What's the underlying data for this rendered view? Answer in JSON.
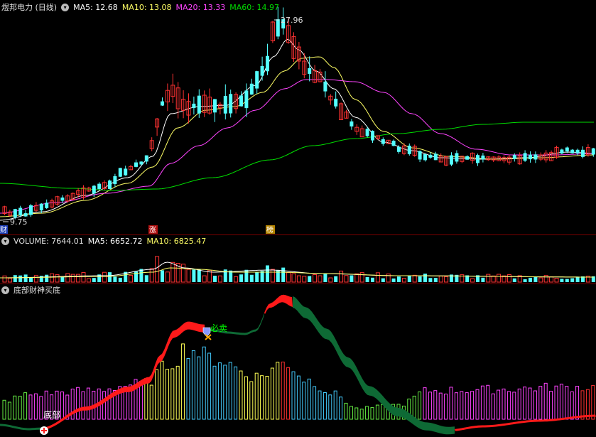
{
  "main": {
    "title": "煜邦电力 (日线)",
    "ma5": "MA5: 12.68",
    "ma10": "MA10: 13.08",
    "ma20": "MA20: 13.33",
    "ma60": "MA60: 14.97",
    "high_label": "27.96",
    "low_label": "9.75",
    "marker_cai": "财",
    "marker_zhang": "涨",
    "marker_bang": "榜"
  },
  "volume": {
    "label": "VOLUME: 7644.01",
    "ma5": "MA5: 6652.72",
    "ma10": "MA10: 6825.47"
  },
  "indicator": {
    "title": "底部财神买底",
    "sell_label": "必卖",
    "bottom_label": "底部"
  },
  "colors": {
    "background": "#000000",
    "separator": "#7a0000",
    "up": "#ff3232",
    "down": "#54ffff",
    "ma5": "#ffffff",
    "ma10": "#ffff66",
    "ma20": "#ff44ff",
    "ma60": "#00dd00",
    "sell_label": "#00ff00",
    "dark_green": "#0e6a35"
  },
  "chart_data": {
    "type": "candlestick",
    "period": "daily",
    "price_high": 27.96,
    "price_low": 9.75,
    "moving_averages": [
      {
        "name": "MA5",
        "value": 12.68
      },
      {
        "name": "MA10",
        "value": 13.08
      },
      {
        "name": "MA20",
        "value": 13.33
      },
      {
        "name": "MA60",
        "value": 14.97
      }
    ],
    "volume_indicators": [
      {
        "name": "VOLUME",
        "value": 7644.01
      },
      {
        "name": "MA5",
        "value": 6652.72
      },
      {
        "name": "MA10",
        "value": 6825.47
      }
    ]
  }
}
